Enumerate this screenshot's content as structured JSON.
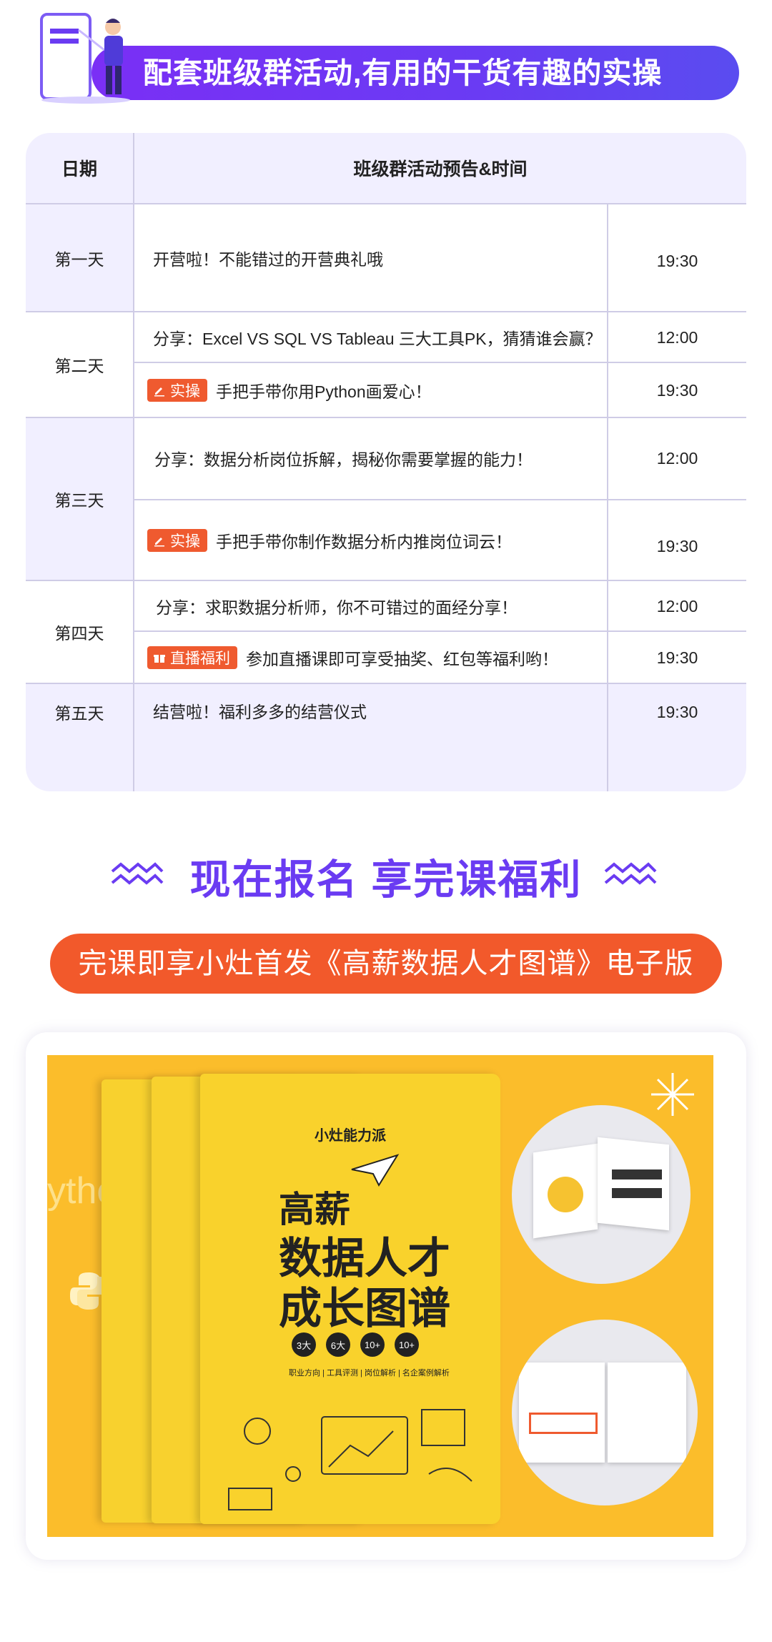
{
  "banner": {
    "title": "配套班级群活动,有用的干货有趣的实操"
  },
  "schedule": {
    "header_date": "日期",
    "header_activity": "班级群活动预告&时间",
    "days": [
      "第一天",
      "第二天",
      "第三天",
      "第四天",
      "第五天"
    ],
    "rows": [
      {
        "tag": "",
        "text": "开营啦！不能错过的开营典礼哦",
        "time": "19:30"
      },
      {
        "tag": "",
        "text": "分享：Excel VS SQL VS Tableau 三大工具PK，猜猜谁会赢？",
        "time": "12:00"
      },
      {
        "tag": "实操",
        "text": "手把手带你用Python画爱心！",
        "time": "19:30"
      },
      {
        "tag": "",
        "text": "分享：数据分析岗位拆解，揭秘你需要掌握的能力！",
        "time": "12:00"
      },
      {
        "tag": "实操",
        "text": "手把手带你制作数据分析内推岗位词云！",
        "time": "19:30"
      },
      {
        "tag": "",
        "text": "分享：求职数据分析师，你不可错过的面经分享！",
        "time": "12:00"
      },
      {
        "tag": "直播福利",
        "text": "参加直播课即可享受抽奖、红包等福利哟！",
        "time": "19:30"
      },
      {
        "tag": "",
        "text": "结营啦！福利多多的结营仪式",
        "time": "19:30"
      }
    ]
  },
  "signup": {
    "title": "现在报名 享完课福利",
    "subtitle": "完课即享小灶首发《高薪数据人才图谱》电子版"
  },
  "product": {
    "brand": "小灶能力派",
    "title_line1": "高薪",
    "title_line2": "数据人才",
    "title_line3": "成长图谱",
    "badges": [
      "3大",
      "6大",
      "10+",
      "10+"
    ],
    "badge_caption": "职业方向 | 工具评测 | 岗位解析 | 名企案例解析",
    "bg_text": "ytho"
  },
  "colors": {
    "purple": "#6a3bf2",
    "orange": "#f2592b",
    "table_bg": "#f1efff",
    "yellow": "#fbbd2b"
  }
}
